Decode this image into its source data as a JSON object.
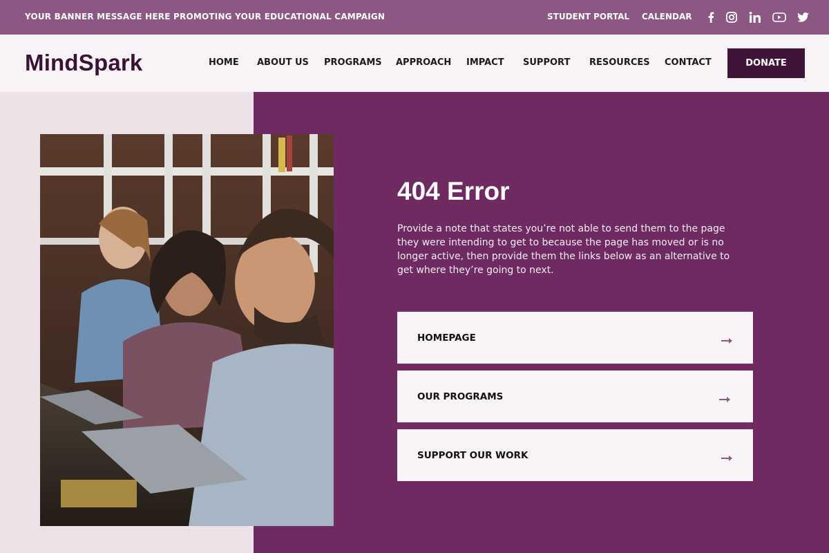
{
  "banner": {
    "message": "YOUR BANNER MESSAGE HERE PROMOTING YOUR EDUCATIONAL CAMPAIGN",
    "links": [
      "STUDENT PORTAL",
      "CALENDAR"
    ],
    "social_icons": [
      "facebook-icon",
      "instagram-icon",
      "linkedin-icon",
      "youtube-icon",
      "twitter-icon"
    ]
  },
  "nav": {
    "logo": "MindSpark",
    "items": [
      "HOME",
      "ABOUT US",
      "PROGRAMS",
      "APPROACH",
      "IMPACT",
      "SUPPORT",
      "RESOURCES",
      "CONTACT"
    ],
    "donate_label": "DONATE"
  },
  "error": {
    "title": "404 Error",
    "description": "Provide a note that states you’re not able to send them to the page they were intending to get to because the page has moved or is no longer active, then provide them the links below as an alternative to get where they’re going to next."
  },
  "links": [
    {
      "label": "HOMEPAGE"
    },
    {
      "label": "OUR PROGRAMS"
    },
    {
      "label": "SUPPORT OUR WORK"
    }
  ],
  "colors": {
    "banner_bg": "#8c5782",
    "nav_bg": "#f7f3f7",
    "accent_dark": "#3f1437",
    "panel_purple": "#6e2a61",
    "left_bg": "#ede1e8",
    "arrow": "#8c5782"
  }
}
